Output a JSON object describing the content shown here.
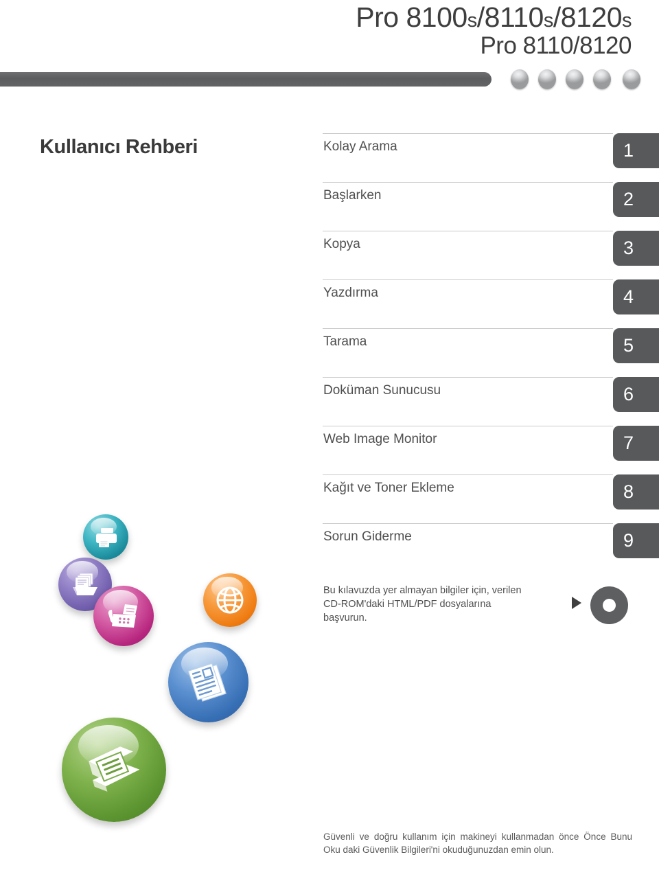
{
  "header": {
    "model_line_1_main": "Pro 8100",
    "model_line_1": "Pro 8100s/8110s/8120s",
    "model_line_2": "Pro 8110/8120",
    "decor_bar": "header-bar",
    "dot_count": 5
  },
  "guide": {
    "title": "Kullanıcı Rehberi"
  },
  "chapters": [
    {
      "number": "1",
      "label": "Kolay Arama"
    },
    {
      "number": "2",
      "label": "Başlarken"
    },
    {
      "number": "3",
      "label": "Kopya"
    },
    {
      "number": "4",
      "label": "Yazdırma"
    },
    {
      "number": "5",
      "label": "Tarama"
    },
    {
      "number": "6",
      "label": "Doküman Sunucusu"
    },
    {
      "number": "7",
      "label": "Web Image Monitor"
    },
    {
      "number": "8",
      "label": "Kağıt ve Toner Ekleme"
    },
    {
      "number": "9",
      "label": "Sorun Giderme"
    }
  ],
  "cd_note": {
    "text": "Bu kılavuzda yer almayan bilgiler için, verilen CD-ROM'daki HTML/PDF dosyalarına başvurun.",
    "arrow": "play-triangle-icon",
    "disc": "cd-rom-icon"
  },
  "footer": {
    "text": "Güvenli ve doğru kullanım için makineyi kullanmadan önce Önce Bunu Oku daki Güvenlik Bilgileri'ni okuduğunuzdan emin olun."
  },
  "decor_icons": [
    {
      "name": "printer-sphere-icon",
      "color": "#1c8d9d"
    },
    {
      "name": "document-tray-sphere-icon",
      "color": "#6f5cab"
    },
    {
      "name": "fax-sphere-icon",
      "color": "#b8277f"
    },
    {
      "name": "globe-sphere-icon",
      "color": "#ef7c12"
    },
    {
      "name": "document-sphere-icon",
      "color": "#376fb5"
    },
    {
      "name": "scanner-sphere-icon",
      "color": "#5b9430"
    }
  ],
  "colors": {
    "tab": "#58595b",
    "bar": "#5c5d5f",
    "text": "#4f4f4f",
    "rule": "#c9c9c9"
  }
}
